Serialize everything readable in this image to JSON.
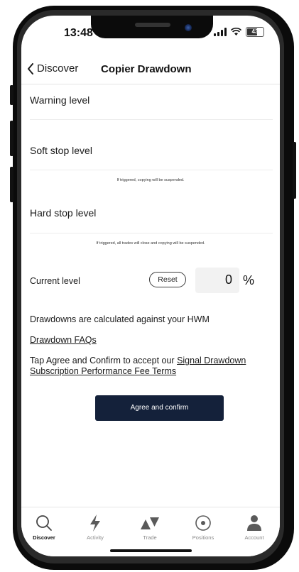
{
  "status_bar": {
    "time": "13:48",
    "battery": "43"
  },
  "nav": {
    "back_label": "Discover",
    "title": "Copier Drawdown"
  },
  "levels": {
    "warning_label": "Warning level",
    "soft_stop_label": "Soft stop level",
    "soft_stop_hint": "If triggered, copying will be suspended.",
    "hard_stop_label": "Hard stop level",
    "hard_stop_hint": "If triggered, all trades will close and copying will be suspended."
  },
  "current": {
    "label": "Current level",
    "reset_label": "Reset",
    "value": "0",
    "unit": "%"
  },
  "info": {
    "hwm_text": "Drawdowns are calculated against your HWM",
    "faq_link": "Drawdown FAQs",
    "agree_prefix": "Tap Agree and Confirm to accept our ",
    "agree_link": "Signal Drawdown Subscription Performance Fee Terms"
  },
  "agree_button": "Agree and confirm",
  "tabbar": {
    "items": [
      {
        "label": "Discover",
        "icon": "search-icon",
        "active": true
      },
      {
        "label": "Activity",
        "icon": "lightning-icon",
        "active": false
      },
      {
        "label": "Trade",
        "icon": "trade-icon",
        "active": false
      },
      {
        "label": "Positions",
        "icon": "positions-icon",
        "active": false
      },
      {
        "label": "Account",
        "icon": "account-icon",
        "active": false
      }
    ]
  },
  "colors": {
    "primary_button": "#14213a",
    "text": "#1a1a1a",
    "field_bg": "#f2f2f2"
  }
}
